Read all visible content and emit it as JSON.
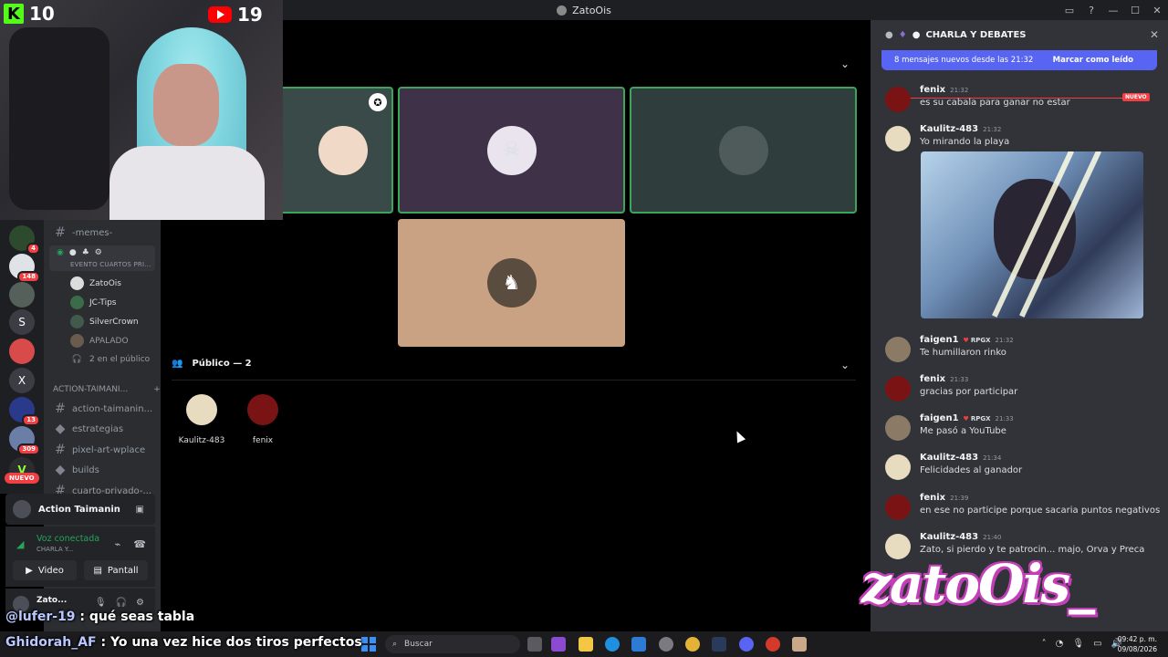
{
  "window": {
    "title": "ZatoOis"
  },
  "stream_counts": {
    "kick": "10",
    "youtube": "19"
  },
  "rail": {
    "badges": [
      "4",
      "148",
      "13",
      "309"
    ],
    "letters": [
      "S",
      "X"
    ],
    "nuevo": "NUEVO"
  },
  "sidebar": {
    "channels_top": [
      {
        "name": "-memes-"
      }
    ],
    "voice_event": "EVENTO CUARTOS PRI...",
    "voice_users": [
      "ZatoOis",
      "JC-Tips",
      "SilverCrown",
      "APALADO"
    ],
    "audience_count": "2 en el público",
    "category": "ACTION-TAIMANI...",
    "category_add": "+",
    "channels": [
      "action-taimanin...",
      "estrategias",
      "pixel-art-wplace",
      "builds",
      "cuarto-privado-..."
    ]
  },
  "bottom_panel": {
    "server": "Action Taimanin",
    "voice_status": "Voz conectada",
    "voice_channel": "CHARLA Y...",
    "video_btn": "Video",
    "screen_btn": "Pantall",
    "username": "Zato..."
  },
  "stage": {
    "audience_header": "Público — 2",
    "audience": [
      "Kaulitz-483",
      "fenix"
    ]
  },
  "chat": {
    "header": "CHARLA Y DEBATES",
    "new_messages": "8 mensajes nuevos desde las 21:32",
    "mark_read": "Marcar como leído",
    "new_tag": "NUEVO",
    "messages": [
      {
        "name": "fenix",
        "time": "21:32",
        "text": "es su cabala para ganar no estar",
        "tag": ""
      },
      {
        "name": "Kaulitz-483",
        "time": "21:32",
        "text": "Yo mirando la playa",
        "tag": ""
      },
      {
        "name": "faigen1",
        "time": "21:32",
        "text": "Te humillaron rinko",
        "tag": "RPGX"
      },
      {
        "name": "fenix",
        "time": "21:33",
        "text": "gracias por participar",
        "tag": ""
      },
      {
        "name": "faigen1",
        "time": "21:33",
        "text": "Me pasó a YouTube",
        "tag": "RPGX"
      },
      {
        "name": "Kaulitz-483",
        "time": "21:34",
        "text": "Felicidades al ganador",
        "tag": ""
      },
      {
        "name": "fenix",
        "time": "21:39",
        "text": "en ese no participe porque sacaria puntos negativos",
        "tag": ""
      },
      {
        "name": "Kaulitz-483",
        "time": "21:40",
        "text": "Zato, si pierdo y te patrocin... majo, Orva y Preca",
        "tag": ""
      }
    ]
  },
  "watermark": "zatoOis_",
  "overlay_chat": [
    {
      "user": "@lufer-19",
      "text": " : qué seas tabla"
    },
    {
      "user": "Ghidorah_AF",
      "text": " : Yo una vez hice dos tiros perfectos"
    }
  ],
  "taskbar": {
    "search_placeholder": "Buscar",
    "time": "09:42 p. m.",
    "date": "09/08/2026"
  },
  "colors": {
    "speaking": "#3ba55c",
    "accent": "#5865f2",
    "danger": "#f23f43"
  }
}
